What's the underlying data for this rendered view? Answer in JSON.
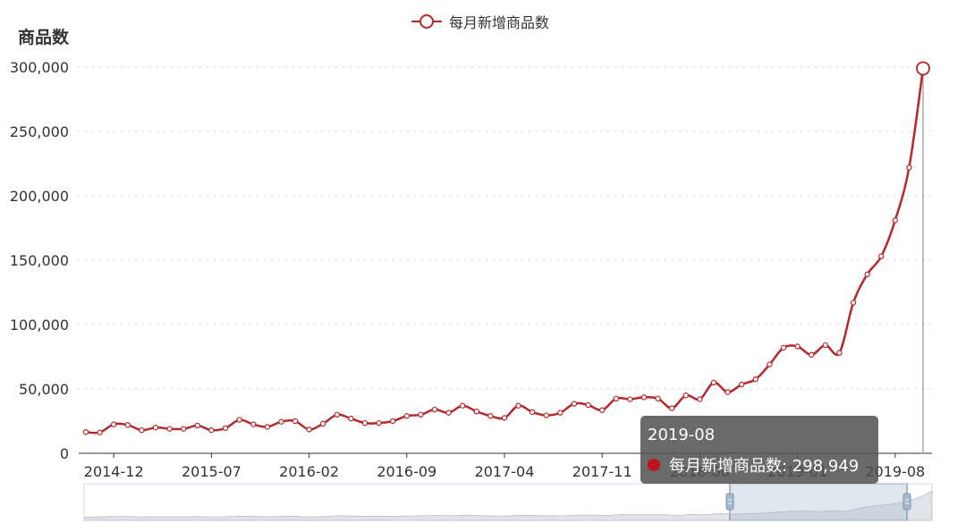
{
  "chart_data": {
    "type": "line",
    "title": "",
    "ylabel": "商品数",
    "xlabel": "",
    "ylim": [
      0,
      300000
    ],
    "y_ticks": [
      0,
      50000,
      100000,
      150000,
      200000,
      250000,
      300000
    ],
    "y_tick_labels": [
      "0",
      "50,000",
      "100,000",
      "150,000",
      "200,000",
      "250,000",
      "300,000"
    ],
    "x_tick_labels": [
      "2014-12",
      "2015-07",
      "2016-02",
      "2016-09",
      "2017-04",
      "2017-11",
      "2018-06",
      "2019-01",
      "2019-08"
    ],
    "legend": {
      "label": "每月新增商品数",
      "position": "top-center"
    },
    "grid": true,
    "colors": {
      "line": "#b5282d",
      "axis": "#333333",
      "grid": "#e0e0e0"
    },
    "x": [
      "2014-10",
      "2014-11",
      "2014-12",
      "2015-01",
      "2015-02",
      "2015-03",
      "2015-04",
      "2015-05",
      "2015-06",
      "2015-07",
      "2015-08",
      "2015-09",
      "2015-10",
      "2015-11",
      "2015-12",
      "2016-01",
      "2016-02",
      "2016-03",
      "2016-04",
      "2016-05",
      "2016-06",
      "2016-07",
      "2016-08",
      "2016-09",
      "2016-10",
      "2016-11",
      "2016-12",
      "2017-01",
      "2017-02",
      "2017-03",
      "2017-04",
      "2017-05",
      "2017-06",
      "2017-07",
      "2017-08",
      "2017-09",
      "2017-10",
      "2017-11",
      "2017-12",
      "2018-01",
      "2018-02",
      "2018-03",
      "2018-04",
      "2018-05",
      "2018-06",
      "2018-07",
      "2018-08",
      "2018-09",
      "2018-10",
      "2018-11",
      "2018-12",
      "2019-01",
      "2019-02",
      "2019-03",
      "2019-04",
      "2019-05",
      "2019-06",
      "2019-07",
      "2019-08"
    ],
    "series": [
      {
        "name": "每月新增商品数",
        "values": [
          16500,
          16200,
          22500,
          22000,
          18000,
          20000,
          19000,
          19000,
          21500,
          18000,
          19500,
          26000,
          22500,
          20500,
          24500,
          25000,
          18500,
          23000,
          30000,
          27000,
          23500,
          23500,
          25000,
          29000,
          30000,
          34000,
          31500,
          37000,
          32500,
          29000,
          27500,
          37000,
          32000,
          29500,
          31500,
          38500,
          37500,
          33500,
          42500,
          42000,
          43500,
          42500,
          35000,
          45000,
          42000,
          55000,
          47500,
          53500,
          57500,
          69000,
          82000,
          83000,
          76500,
          84000,
          78000,
          117000,
          139000,
          153000,
          181000,
          222000,
          298949
        ]
      }
    ],
    "data_zoom": {
      "range": [
        "2018-06",
        "2019-08"
      ]
    }
  },
  "tooltip": {
    "date": "2019-08",
    "text": "每月新增商品数: 298,949"
  }
}
